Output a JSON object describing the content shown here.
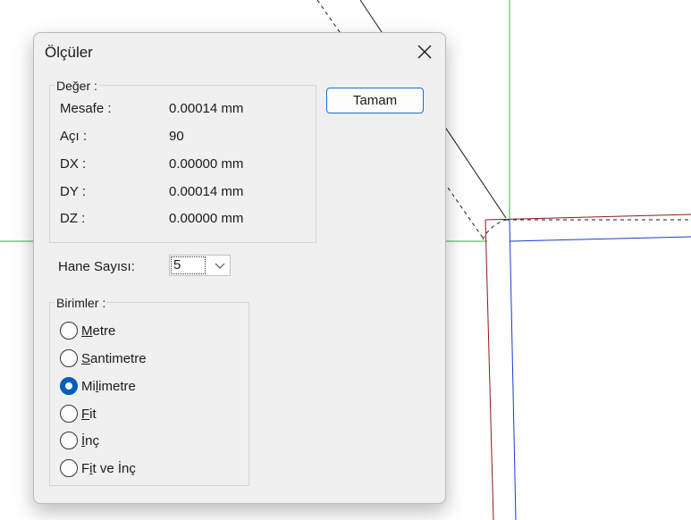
{
  "dialog": {
    "title": "Ölçüler",
    "ok_label": "Tamam",
    "value_group": {
      "legend": "Değer :",
      "rows": [
        {
          "label": "Mesafe :",
          "value": "0.00014 mm"
        },
        {
          "label": "Açı :",
          "value": "90"
        },
        {
          "label": "DX :",
          "value": "0.00000 mm"
        },
        {
          "label": "DY :",
          "value": "0.00014 mm"
        },
        {
          "label": "DZ :",
          "value": "0.00000 mm"
        }
      ]
    },
    "decimals": {
      "label": "Hane Sayısı:",
      "value": "5"
    },
    "units": {
      "legend": "Birimler :",
      "options": [
        {
          "pre": "",
          "key": "M",
          "post": "etre",
          "checked": false
        },
        {
          "pre": "",
          "key": "S",
          "post": "antimetre",
          "checked": false
        },
        {
          "pre": "Mi",
          "key": "l",
          "post": "imetre",
          "checked": true
        },
        {
          "pre": "",
          "key": "F",
          "post": "it",
          "checked": false
        },
        {
          "pre": "",
          "key": "İ",
          "post": "nç",
          "checked": false
        },
        {
          "pre": "F",
          "key": "i",
          "post": "t ve İnç",
          "checked": false
        }
      ]
    }
  },
  "icons": {
    "close": "close-icon",
    "dropdown": "chevron-down-icon"
  }
}
